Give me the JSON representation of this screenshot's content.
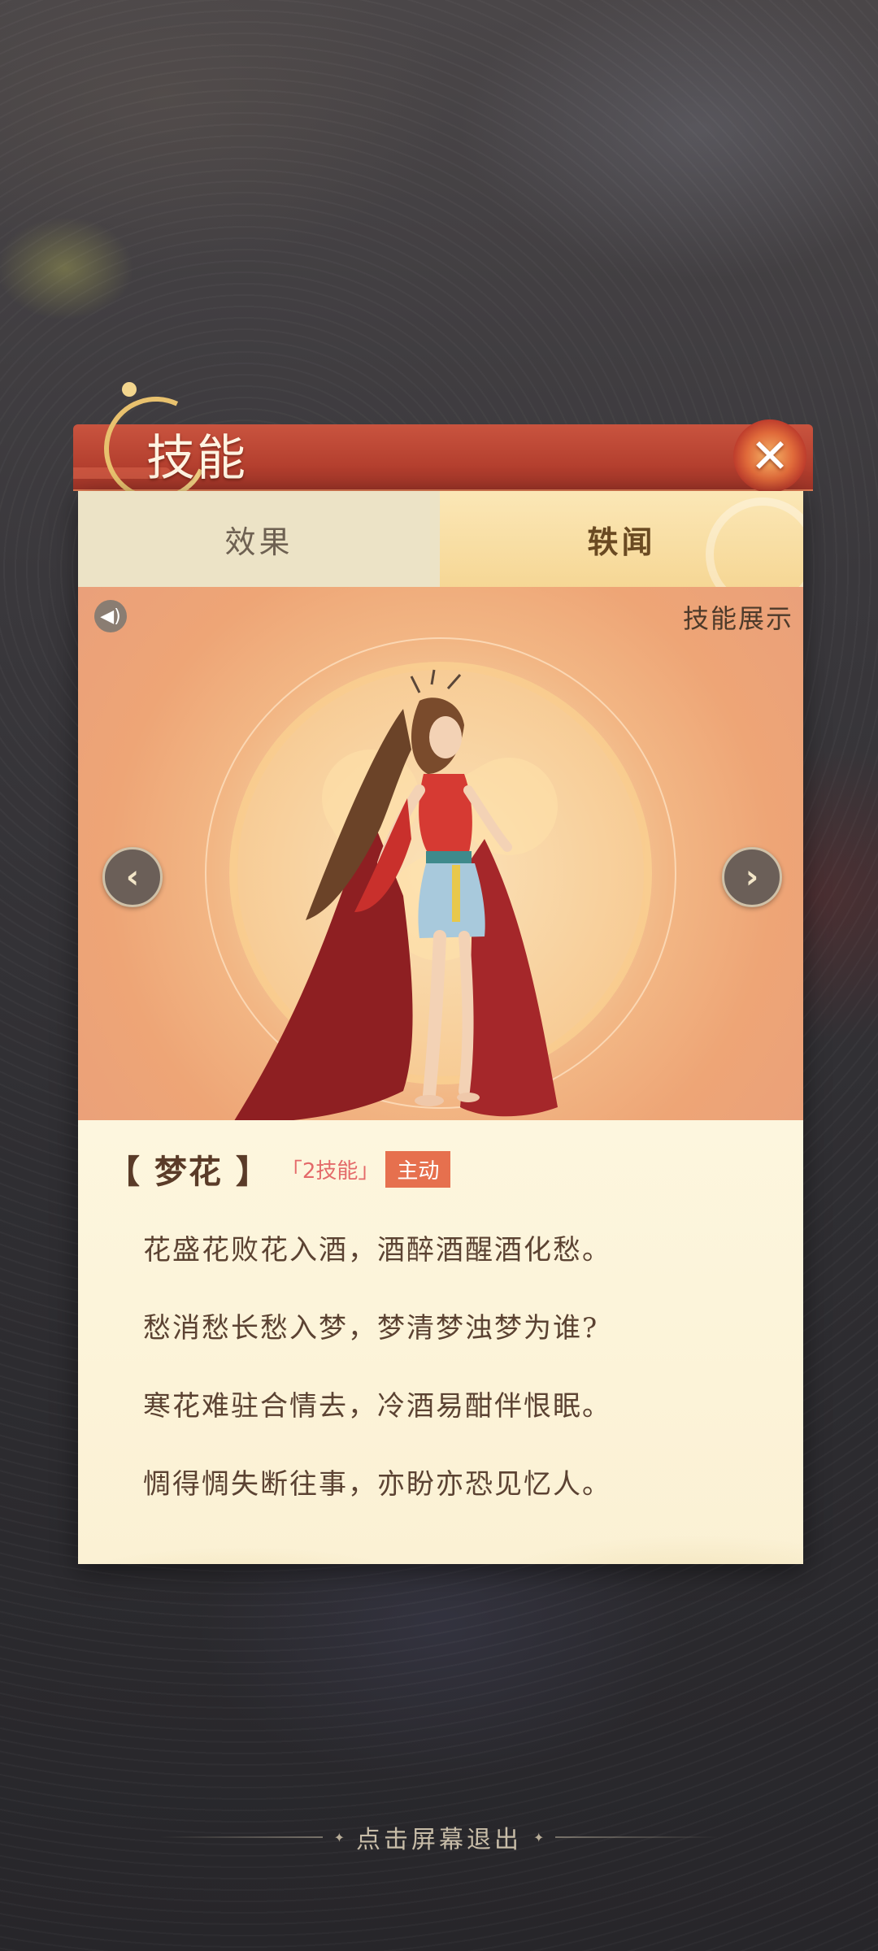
{
  "dialog": {
    "title": "技能",
    "close_icon": "close-icon"
  },
  "tabs": [
    {
      "label": "效果",
      "active": false
    },
    {
      "label": "轶闻",
      "active": true
    }
  ],
  "showcase": {
    "label": "技能展示",
    "sound_icon": "speaker-icon",
    "prev_icon": "chevron-left-icon",
    "next_icon": "chevron-right-icon"
  },
  "skill": {
    "name": "【 梦花 】",
    "tag": "「2技能」",
    "type": "主动",
    "poem": [
      "花盛花败花入酒，酒醉酒醒酒化愁。",
      "愁消愁长愁入梦，梦清梦浊梦为谁?",
      "寒花难驻合情去，冷酒易酣伴恨眠。",
      "惆得惆失断往事，亦盼亦恐见忆人。"
    ]
  },
  "footer": {
    "exit_hint": "点击屏幕退出"
  },
  "colors": {
    "header_red": "#b5402f",
    "accent_gold": "#e8c16e",
    "tag_pink": "#e46a6a",
    "type_orange": "#e6704e"
  }
}
